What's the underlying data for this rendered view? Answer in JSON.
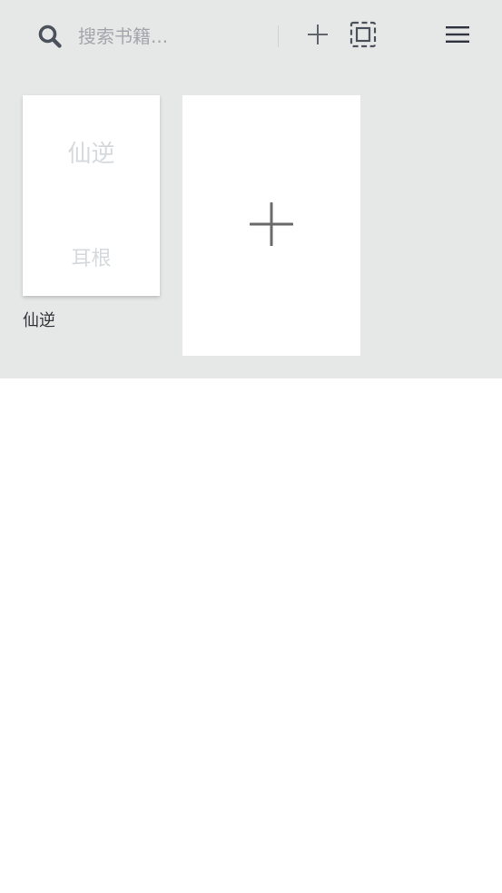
{
  "toolbar": {
    "search_placeholder": "搜索书籍...",
    "search_value": ""
  },
  "icons": {
    "search": "search-icon",
    "add": "plus-icon",
    "select": "select-all-icon",
    "menu": "hamburger-menu-icon",
    "add_book": "plus-icon"
  },
  "books": [
    {
      "cover_title": "仙逆",
      "cover_author": "耳根",
      "name": "仙逆"
    }
  ],
  "colors": {
    "shelf_background": "#e6e7e7",
    "icon_dark": "#3f4650",
    "icon_gray": "#5f646b",
    "placeholder": "#a3a7ad",
    "cover_text": "#d6d9dc"
  }
}
